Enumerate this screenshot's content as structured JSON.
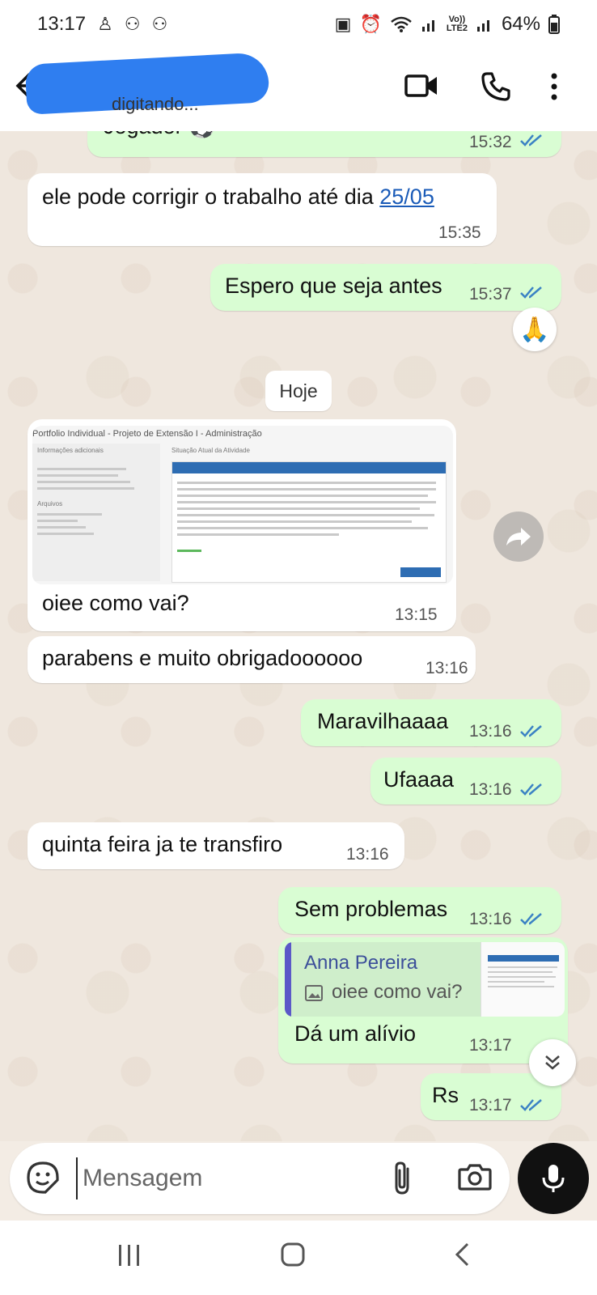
{
  "status_bar": {
    "time": "13:17",
    "battery": "64%",
    "network_label_top": "Vo))",
    "network_label_bottom": "LTE2"
  },
  "header": {
    "contact_status": "digitando..."
  },
  "messages": [
    {
      "dir": "out",
      "text": "Jogador ⚽",
      "time": "15:32",
      "read": true
    },
    {
      "dir": "in",
      "text_before": "ele pode corrigir o trabalho até dia ",
      "link": "25/05",
      "time": "15:35"
    },
    {
      "dir": "out",
      "text": "Espero que seja antes",
      "time": "15:37",
      "read": true,
      "reaction": "🙏"
    },
    {
      "dir": "in",
      "text": "oiee como vai?",
      "time": "13:15",
      "has_image": true
    },
    {
      "dir": "in",
      "text": "parabens e muito obrigadoooooo",
      "time": "13:16"
    },
    {
      "dir": "out",
      "text": "Maravilhaaaa",
      "time": "13:16",
      "read": true
    },
    {
      "dir": "out",
      "text": "Ufaaaa",
      "time": "13:16",
      "read": true
    },
    {
      "dir": "in",
      "text": "quinta feira ja te transfiro",
      "time": "13:16"
    },
    {
      "dir": "out",
      "text": "Sem problemas",
      "time": "13:16",
      "read": true
    },
    {
      "dir": "out",
      "text": "Dá um alívio",
      "time": "13:17",
      "read": true,
      "quote": {
        "author": "Anna Pereira",
        "text": "oiee como vai?"
      }
    },
    {
      "dir": "out",
      "text": "Rs",
      "time": "13:17",
      "read": true
    }
  ],
  "date_chip": "Hoje",
  "image_preview": {
    "title": "Portfolio Individual - Projeto de Extensão I - Administração",
    "left_heading": "Informações adicionais",
    "right_heading": "Situação Atual da Atividade",
    "files_heading": "Arquivos"
  },
  "composer": {
    "placeholder": "Mensagem"
  },
  "colors": {
    "incoming_bubble": "#ffffff",
    "outgoing_bubble": "#d9fdd3",
    "read_ticks": "#3b82c4",
    "chat_background": "#efe7de"
  }
}
